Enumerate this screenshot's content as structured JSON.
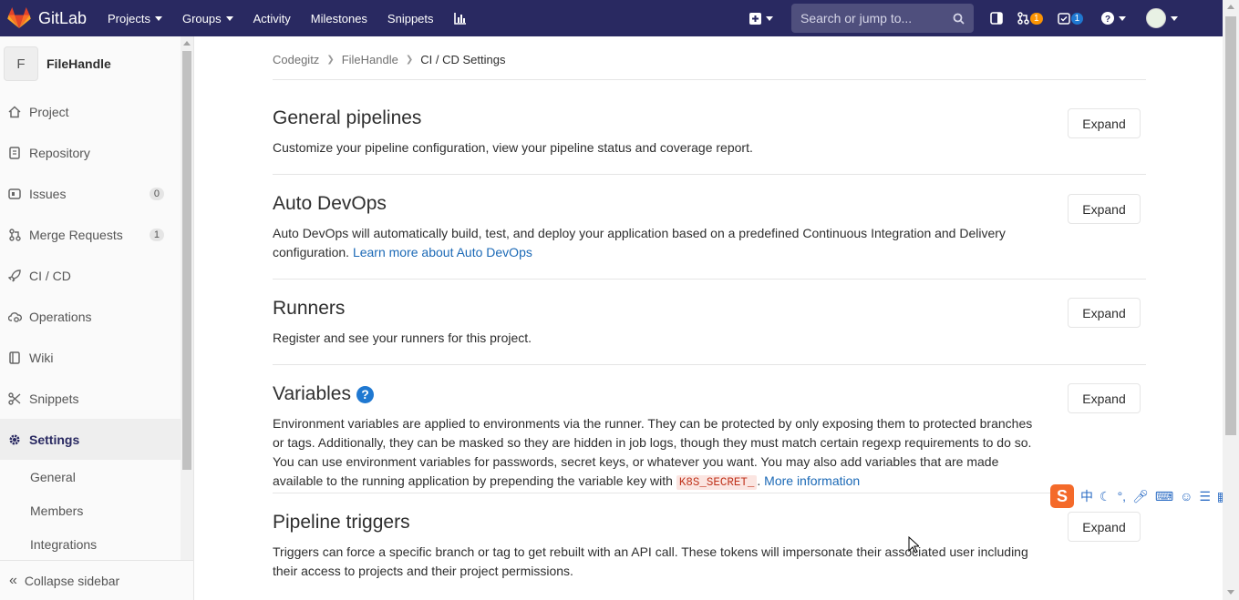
{
  "navbar": {
    "brand": "GitLab",
    "links": [
      {
        "label": "Projects",
        "dropdown": true
      },
      {
        "label": "Groups",
        "dropdown": true
      },
      {
        "label": "Activity",
        "dropdown": false
      },
      {
        "label": "Milestones",
        "dropdown": false
      },
      {
        "label": "Snippets",
        "dropdown": false
      }
    ],
    "search_placeholder": "Search or jump to...",
    "merge_requests_count": "1",
    "todos_count": "1"
  },
  "sidebar": {
    "project_initial": "F",
    "project_name": "FileHandle",
    "items": [
      {
        "label": "Project",
        "icon": "home-icon"
      },
      {
        "label": "Repository",
        "icon": "doc-icon"
      },
      {
        "label": "Issues",
        "icon": "issues-icon",
        "count": "0"
      },
      {
        "label": "Merge Requests",
        "icon": "merge-request-icon",
        "count": "1"
      },
      {
        "label": "CI / CD",
        "icon": "rocket-icon"
      },
      {
        "label": "Operations",
        "icon": "cloud-gear-icon"
      },
      {
        "label": "Wiki",
        "icon": "book-icon"
      },
      {
        "label": "Snippets",
        "icon": "scissors-icon"
      },
      {
        "label": "Settings",
        "icon": "gear-icon"
      }
    ],
    "sub_items": [
      "General",
      "Members",
      "Integrations"
    ],
    "collapse_label": "Collapse sidebar"
  },
  "breadcrumb": [
    "Codegitz",
    "FileHandle",
    "CI / CD Settings"
  ],
  "sections": {
    "general": {
      "title": "General pipelines",
      "description": "Customize your pipeline configuration, view your pipeline status and coverage report.",
      "button": "Expand"
    },
    "autodevops": {
      "title": "Auto DevOps",
      "description": "Auto DevOps will automatically build, test, and deploy your application based on a predefined Continuous Integration and Delivery configuration.",
      "link": "Learn more about Auto DevOps",
      "button": "Expand"
    },
    "runners": {
      "title": "Runners",
      "description": "Register and see your runners for this project.",
      "button": "Expand"
    },
    "variables": {
      "title": "Variables",
      "description": "Environment variables are applied to environments via the runner. They can be protected by only exposing them to protected branches or tags. Additionally, they can be masked so they are hidden in job logs, though they must match certain regexp requirements to do so. You can use environment variables for passwords, secret keys, or whatever you want. You may also add variables that are made available to the running application by prepending the variable key with",
      "code": "K8S_SECRET_",
      "link": "More information",
      "button": "Expand"
    },
    "triggers": {
      "title": "Pipeline triggers",
      "description": "Triggers can force a specific branch or tag to get rebuilt with an API call. These tokens will impersonate their associated user including their access to projects and their project permissions.",
      "button": "Expand"
    }
  },
  "ime": {
    "logo": "S",
    "lang": "中"
  },
  "colors": {
    "navbar": "#292961",
    "link": "#1b69b6",
    "accent_orange": "#fc9403",
    "badge_blue": "#1f78d1"
  }
}
